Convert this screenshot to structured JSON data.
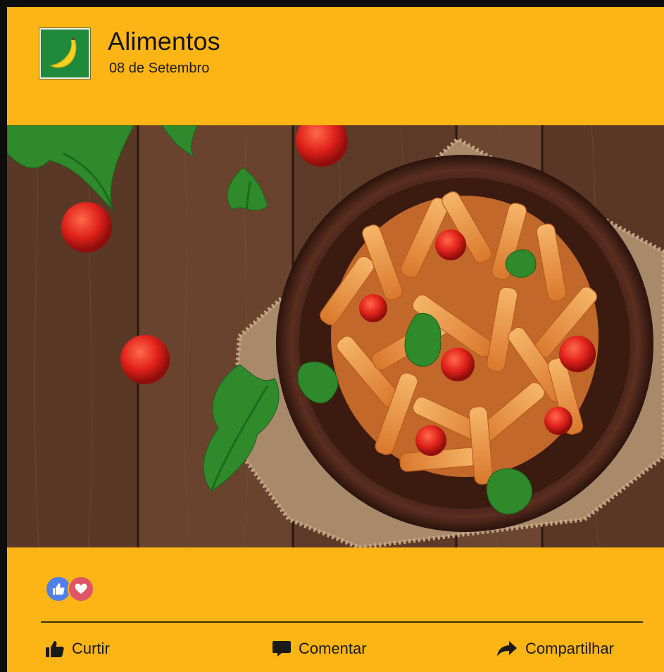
{
  "post": {
    "page_name": "Alimentos",
    "date": "08 de Setembro",
    "avatar_icon": "banana-icon",
    "photo_icon": "penne-pasta-plate-photo"
  },
  "reactions": {
    "icons": [
      "like-reaction-icon",
      "love-reaction-icon"
    ]
  },
  "actions": {
    "like_label": "Curtir",
    "comment_label": "Comentar",
    "share_label": "Compartilhar"
  },
  "colors": {
    "card_background": "#fdb515",
    "avatar_background": "#1f8a3c",
    "like_blue": "#4f7fe8",
    "love_red": "#e05566"
  }
}
